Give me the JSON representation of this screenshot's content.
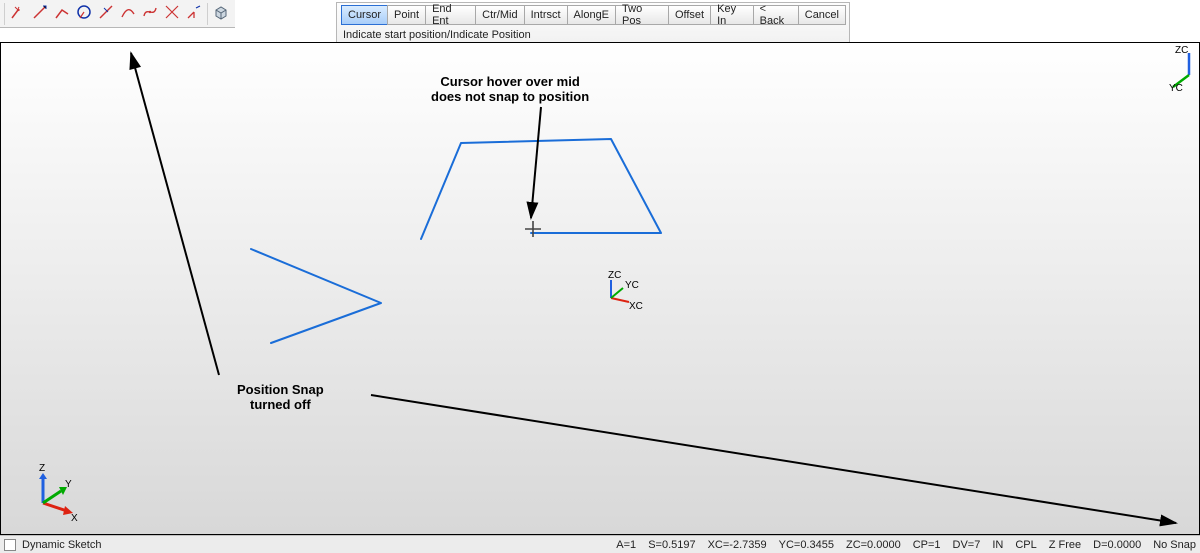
{
  "toolbar": {
    "tool_icons": [
      "spark-tool",
      "line-tool",
      "angle-line-tool",
      "circle-tool",
      "tangent-line-tool",
      "arc-tool",
      "spline-tool",
      "cross-line-tool",
      "corner-line-tool",
      "cube-tool"
    ]
  },
  "mode_toolbar": {
    "buttons": [
      {
        "label": "Cursor",
        "selected": true
      },
      {
        "label": "Point",
        "selected": false
      },
      {
        "label": "End Ent",
        "selected": false
      },
      {
        "label": "Ctr/Mid",
        "selected": false
      },
      {
        "label": "Intrsct",
        "selected": false
      },
      {
        "label": "AlongE",
        "selected": false
      },
      {
        "label": "Two Pos",
        "selected": false
      },
      {
        "label": "Offset",
        "selected": false
      },
      {
        "label": "Key In",
        "selected": false
      }
    ],
    "nav": {
      "back": "< Back",
      "cancel": "Cancel"
    },
    "hint": "Indicate start position/Indicate Position"
  },
  "annotations": {
    "hover": "Cursor hover over mid\ndoes not snap to position",
    "snap": "Position Snap\nturned off"
  },
  "center_triad": {
    "labels": [
      "ZC",
      "YC",
      "XC"
    ]
  },
  "corner_triad": {
    "labels": [
      "Z",
      "Y",
      "X"
    ]
  },
  "topright_triad": {
    "labels": [
      "ZC",
      "YC"
    ]
  },
  "status": {
    "mode": "Dynamic Sketch",
    "fields": {
      "A": "A=1",
      "S": "S=0.5197",
      "XC": "XC=-2.7359",
      "YC": "YC=0.3455",
      "ZC": "ZC=0.0000",
      "CP": "CP=1",
      "DV": "DV=7",
      "IN": "IN",
      "CPL": "CPL",
      "ZFree": "Z Free",
      "D": "D=0.0000",
      "Snap": "No Snap"
    }
  }
}
